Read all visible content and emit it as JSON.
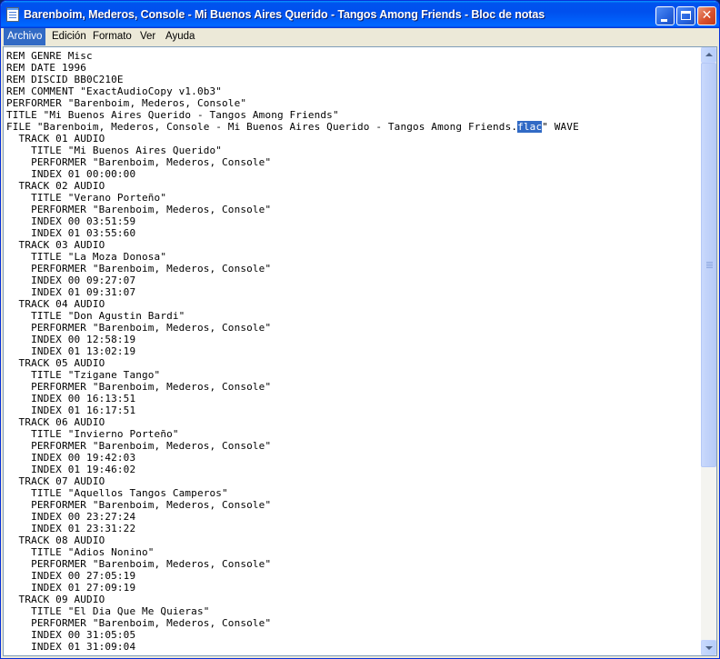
{
  "window": {
    "title": "Barenboim, Mederos, Console - Mi Buenos Aires Querido - Tangos Among Friends - Bloc de notas",
    "controls": {
      "minimize": "minimize",
      "maximize": "maximize",
      "close": "✕"
    }
  },
  "menu": [
    {
      "label": "Archivo",
      "active": true
    },
    {
      "label": "Edición",
      "active": false
    },
    {
      "label": "Formato",
      "active": false
    },
    {
      "label": "Ver",
      "active": false
    },
    {
      "label": "Ayuda",
      "active": false
    }
  ],
  "document": {
    "lines_before": [
      "REM GENRE Misc",
      "REM DATE 1996",
      "REM DISCID BB0C210E",
      "REM COMMENT \"ExactAudioCopy v1.0b3\"",
      "PERFORMER \"Barenboim, Mederos, Console\"",
      "TITLE \"Mi Buenos Aires Querido - Tangos Among Friends\""
    ],
    "file_line_prefix": "FILE \"Barenboim, Mederos, Console - Mi Buenos Aires Querido - Tangos Among Friends.",
    "selected_text": "flac",
    "file_line_suffix": "\" WAVE",
    "lines_after": [
      "  TRACK 01 AUDIO",
      "    TITLE \"Mi Buenos Aires Querido\"",
      "    PERFORMER \"Barenboim, Mederos, Console\"",
      "    INDEX 01 00:00:00",
      "  TRACK 02 AUDIO",
      "    TITLE \"Verano Porteño\"",
      "    PERFORMER \"Barenboim, Mederos, Console\"",
      "    INDEX 00 03:51:59",
      "    INDEX 01 03:55:60",
      "  TRACK 03 AUDIO",
      "    TITLE \"La Moza Donosa\"",
      "    PERFORMER \"Barenboim, Mederos, Console\"",
      "    INDEX 00 09:27:07",
      "    INDEX 01 09:31:07",
      "  TRACK 04 AUDIO",
      "    TITLE \"Don Agustin Bardi\"",
      "    PERFORMER \"Barenboim, Mederos, Console\"",
      "    INDEX 00 12:58:19",
      "    INDEX 01 13:02:19",
      "  TRACK 05 AUDIO",
      "    TITLE \"Tzigane Tango\"",
      "    PERFORMER \"Barenboim, Mederos, Console\"",
      "    INDEX 00 16:13:51",
      "    INDEX 01 16:17:51",
      "  TRACK 06 AUDIO",
      "    TITLE \"Invierno Porteño\"",
      "    PERFORMER \"Barenboim, Mederos, Console\"",
      "    INDEX 00 19:42:03",
      "    INDEX 01 19:46:02",
      "  TRACK 07 AUDIO",
      "    TITLE \"Aquellos Tangos Camperos\"",
      "    PERFORMER \"Barenboim, Mederos, Console\"",
      "    INDEX 00 23:27:24",
      "    INDEX 01 23:31:22",
      "  TRACK 08 AUDIO",
      "    TITLE \"Adios Nonino\"",
      "    PERFORMER \"Barenboim, Mederos, Console\"",
      "    INDEX 00 27:05:19",
      "    INDEX 01 27:09:19",
      "  TRACK 09 AUDIO",
      "    TITLE \"El Dia Que Me Quieras\"",
      "    PERFORMER \"Barenboim, Mederos, Console\"",
      "    INDEX 00 31:05:05",
      "    INDEX 01 31:09:04"
    ]
  },
  "scrollbar": {
    "position_fraction": 0.0,
    "visible_fraction": 0.7,
    "colors": {
      "thumb": "#b6cbf7",
      "track": "#f4f4f0"
    }
  },
  "colors": {
    "titlebar": "#0053ee",
    "selection": "#316ac5",
    "menu_bg": "#ece9d8"
  }
}
